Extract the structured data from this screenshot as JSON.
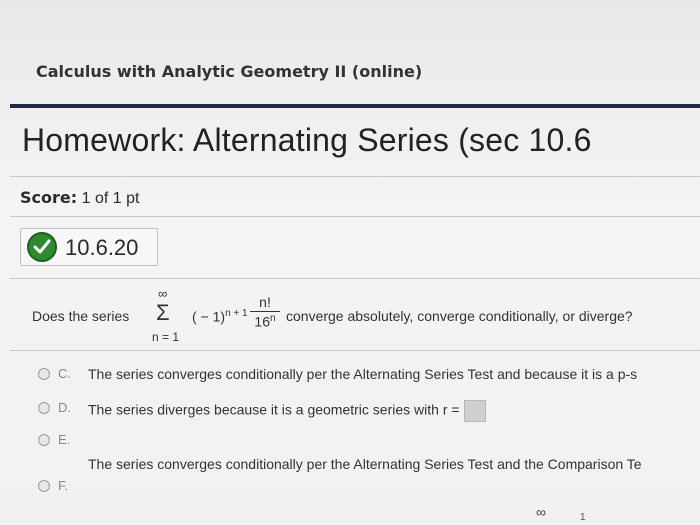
{
  "course": {
    "title": "Calculus with Analytic Geometry II (online)"
  },
  "homework": {
    "title": "Homework: Alternating Series (sec 10.6"
  },
  "score": {
    "label": "Score:",
    "value": "1 of 1 pt"
  },
  "problem": {
    "number": "10.6.20",
    "status_icon": "check-circle-icon",
    "status_color": "#2e8a2e"
  },
  "question": {
    "prefix": "Does the series",
    "sum_upper": "∞",
    "sum_symbol": "Σ",
    "sum_lower": "n = 1",
    "term_base": "( − 1)",
    "term_exponent": "n + 1",
    "fraction_numerator": "n!",
    "fraction_denominator_base": "16",
    "fraction_denominator_exponent": "n",
    "suffix": "converge absolutely, converge conditionally, or diverge?"
  },
  "choices": [
    {
      "letter": "C.",
      "text": "The series converges conditionally per the Alternating Series Test and because it is a p-s"
    },
    {
      "letter": "D.",
      "text": "The series diverges because it is a geometric series with r ="
    },
    {
      "letter": "E.",
      "text": "The series converges conditionally per the Alternating Series Test and the Comparison Te"
    },
    {
      "letter": "F.",
      "text": ""
    }
  ],
  "footer_fragment": {
    "infinity": "∞",
    "one": "1"
  }
}
